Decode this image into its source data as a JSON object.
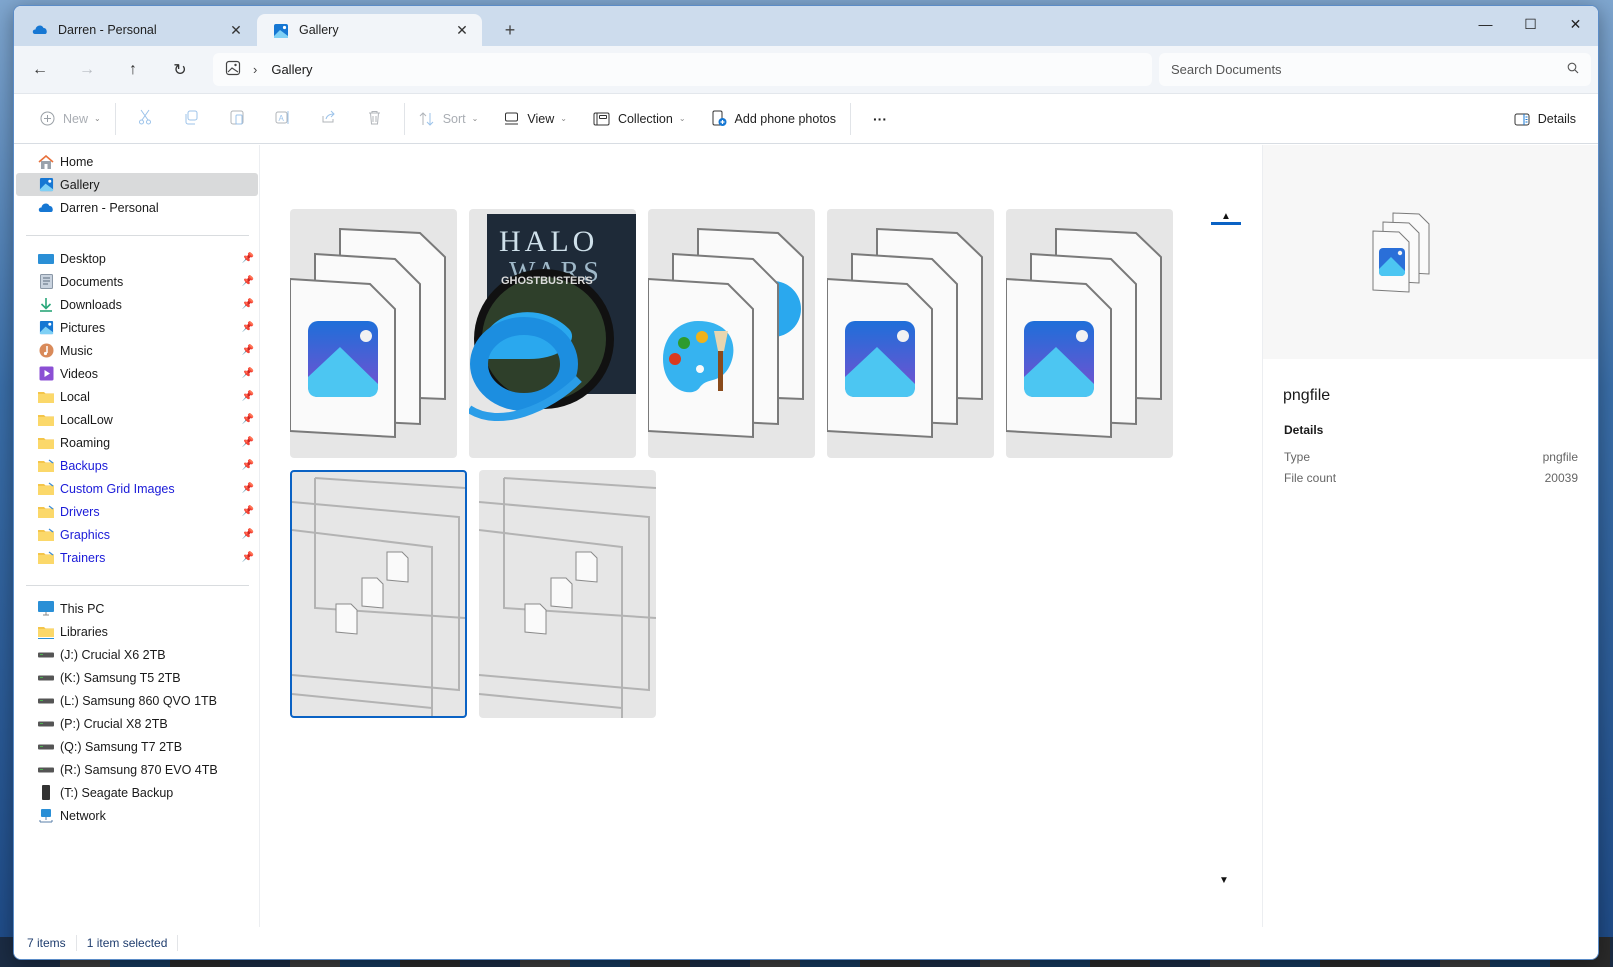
{
  "window": {
    "tabs": [
      {
        "label": "Darren - Personal",
        "icon": "onedrive-cloud-icon",
        "active": false
      },
      {
        "label": "Gallery",
        "icon": "gallery-icon",
        "active": true
      }
    ],
    "new_tab": "+",
    "controls": {
      "minimize": "—",
      "maximize": "☐",
      "close": "✕"
    }
  },
  "addressbar": {
    "back": "←",
    "forward": "→",
    "up": "↑",
    "refresh": "↻",
    "breadcrumb": [
      {
        "label": "Gallery"
      }
    ],
    "separator": "›",
    "search_placeholder": "Search Documents",
    "search_value": ""
  },
  "commandbar": {
    "new": "New",
    "sort": "Sort",
    "view": "View",
    "collection": "Collection",
    "add_phone_photos": "Add phone photos",
    "more": "···",
    "details": "Details",
    "icons": [
      "cut-icon",
      "copy-icon",
      "paste-icon",
      "rename-icon",
      "share-icon",
      "delete-icon"
    ]
  },
  "sidebar": {
    "top": [
      {
        "label": "Home",
        "icon": "home-icon"
      },
      {
        "label": "Gallery",
        "icon": "gallery-icon",
        "selected": true
      },
      {
        "label": "Darren - Personal",
        "icon": "onedrive-cloud-icon"
      }
    ],
    "quick_access": [
      {
        "label": "Desktop",
        "icon": "desktop-icon",
        "pinned": true
      },
      {
        "label": "Documents",
        "icon": "documents-icon",
        "pinned": true
      },
      {
        "label": "Downloads",
        "icon": "downloads-icon",
        "pinned": true
      },
      {
        "label": "Pictures",
        "icon": "pictures-icon",
        "pinned": true
      },
      {
        "label": "Music",
        "icon": "music-icon",
        "pinned": true
      },
      {
        "label": "Videos",
        "icon": "videos-icon",
        "pinned": true
      },
      {
        "label": "Local",
        "icon": "folder-icon",
        "pinned": true
      },
      {
        "label": "LocalLow",
        "icon": "folder-icon",
        "pinned": true
      },
      {
        "label": "Roaming",
        "icon": "folder-icon",
        "pinned": true
      },
      {
        "label": "Backups",
        "icon": "folder-shortcut-icon",
        "pinned": true,
        "link": true
      },
      {
        "label": "Custom Grid Images",
        "icon": "folder-shortcut-icon",
        "pinned": true,
        "link": true
      },
      {
        "label": "Drivers",
        "icon": "folder-shortcut-icon",
        "pinned": true,
        "link": true
      },
      {
        "label": "Graphics",
        "icon": "folder-shortcut-icon",
        "pinned": true,
        "link": true
      },
      {
        "label": "Trainers",
        "icon": "folder-shortcut-icon",
        "pinned": true,
        "link": true
      }
    ],
    "computer": [
      {
        "label": "This PC",
        "icon": "this-pc-icon"
      },
      {
        "label": "Libraries",
        "icon": "libraries-icon"
      },
      {
        "label": "(J:) Crucial X6 2TB",
        "icon": "drive-icon"
      },
      {
        "label": "(K:) Samsung T5 2TB",
        "icon": "drive-icon"
      },
      {
        "label": "(L:) Samsung 860 QVO 1TB",
        "icon": "drive-icon"
      },
      {
        "label": "(P:) Crucial X8 2TB",
        "icon": "drive-icon"
      },
      {
        "label": "(Q:) Samsung T7 2TB",
        "icon": "drive-icon"
      },
      {
        "label": "(R:) Samsung 870 EVO 4TB",
        "icon": "drive-icon"
      },
      {
        "label": "(T:) Seagate Backup",
        "icon": "external-drive-icon"
      },
      {
        "label": "Network",
        "icon": "network-icon"
      }
    ],
    "pin_glyph": "📌"
  },
  "gallery": {
    "items": [
      {
        "kind": "photos-stack",
        "selected": false
      },
      {
        "kind": "custom-image-stack",
        "selected": false
      },
      {
        "kind": "paint-stack",
        "selected": false
      },
      {
        "kind": "photos-stack",
        "selected": false
      },
      {
        "kind": "photos-stack",
        "selected": false
      },
      {
        "kind": "generic-stack",
        "selected": true
      },
      {
        "kind": "generic-stack",
        "selected": false
      }
    ],
    "scroll_up": "▲",
    "scroll_down": "▼"
  },
  "details_pane": {
    "title": "pngfile",
    "section": "Details",
    "rows": [
      {
        "label": "Type",
        "value": "pngfile"
      },
      {
        "label": "File count",
        "value": "20039"
      }
    ]
  },
  "statusbar": {
    "item_count": "7 items",
    "selection": "1 item selected"
  },
  "colors": {
    "accent": "#0a62c4",
    "titlebar": "#cddced",
    "selected_nav": "#d9dadb",
    "link_text": "#1a1ad8"
  }
}
